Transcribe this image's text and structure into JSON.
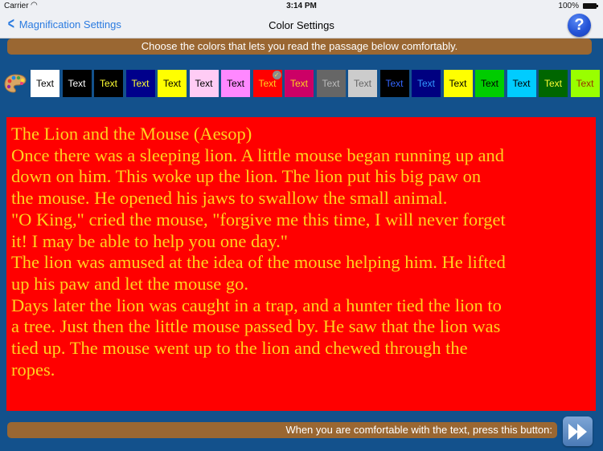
{
  "status_bar": {
    "carrier": "Carrier",
    "time": "3:14 PM",
    "battery": "100%"
  },
  "nav": {
    "back_label": "Magnification Settings",
    "title": "Color Settings",
    "help_label": "?"
  },
  "instructions": "Choose the colors that lets you read the passage below comfortably.",
  "swatches": [
    {
      "label": "Text",
      "bg": "#ffffff",
      "fg": "#000000",
      "selected": false
    },
    {
      "label": "Text",
      "bg": "#000000",
      "fg": "#ffffff",
      "selected": false
    },
    {
      "label": "Text",
      "bg": "#000000",
      "fg": "#ffff33",
      "selected": false
    },
    {
      "label": "Text",
      "bg": "#00008b",
      "fg": "#ffff33",
      "selected": false
    },
    {
      "label": "Text",
      "bg": "#ffff00",
      "fg": "#000000",
      "selected": false
    },
    {
      "label": "Text",
      "bg": "#ffccf5",
      "fg": "#000000",
      "selected": false
    },
    {
      "label": "Text",
      "bg": "#ff88ff",
      "fg": "#000000",
      "selected": false
    },
    {
      "label": "Text",
      "bg": "#ff0000",
      "fg": "#ffd21f",
      "selected": true
    },
    {
      "label": "Text",
      "bg": "#cc0066",
      "fg": "#ffd21f",
      "selected": false
    },
    {
      "label": "Text",
      "bg": "#666666",
      "fg": "#bbbbbb",
      "selected": false
    },
    {
      "label": "Text",
      "bg": "#cccccc",
      "fg": "#666666",
      "selected": false
    },
    {
      "label": "Text",
      "bg": "#000000",
      "fg": "#3366ff",
      "selected": false
    },
    {
      "label": "Text",
      "bg": "#000080",
      "fg": "#3399ff",
      "selected": false
    },
    {
      "label": "Text",
      "bg": "#ffff00",
      "fg": "#000000",
      "selected": false
    },
    {
      "label": "Text",
      "bg": "#00cc00",
      "fg": "#000000",
      "selected": false
    },
    {
      "label": "Text",
      "bg": "#00ccff",
      "fg": "#000000",
      "selected": false
    },
    {
      "label": "Text",
      "bg": "#006600",
      "fg": "#ffff33",
      "selected": false
    },
    {
      "label": "Text",
      "bg": "#99ff00",
      "fg": "#993300",
      "selected": false
    }
  ],
  "passage": {
    "bg": "#ff0000",
    "fg": "#ffd21f",
    "lines": [
      "The Lion and the Mouse (Aesop)",
      "Once there was a sleeping lion. A little mouse began running up and",
      "down on him. This woke up the lion. The lion put his big paw on",
      "the mouse. He opened his jaws to swallow the small animal.",
      "\"O King,\" cried the mouse, \"forgive me this time, I will never forget",
      "it! I may be able to help you one day.\"",
      "The lion was amused at the idea of the mouse helping him. He lifted",
      "up his paw and let the mouse go.",
      "Days later the lion was caught in a trap, and a hunter tied the lion to",
      "a tree. Just then the little mouse passed by. He saw that the lion was",
      "tied up. The mouse went up to the lion and chewed through the",
      "ropes."
    ]
  },
  "footer": {
    "prompt": "When you are comfortable with the text, press this button:"
  }
}
